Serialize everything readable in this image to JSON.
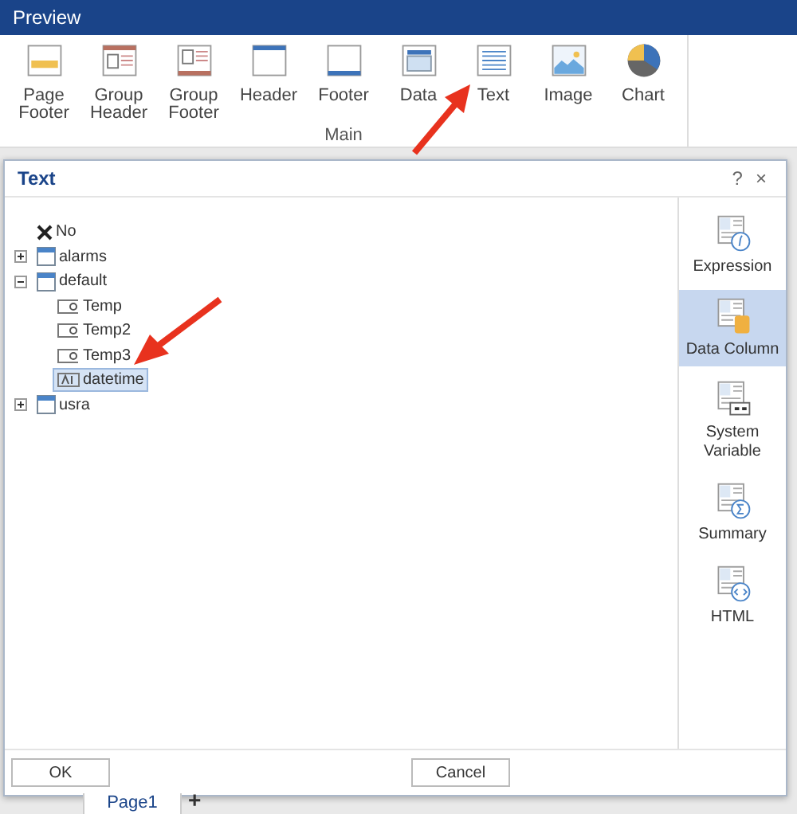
{
  "window": {
    "title": "Preview"
  },
  "ribbon": {
    "group_label": "Main",
    "items": [
      {
        "label": "Page Footer",
        "kind": "page-footer"
      },
      {
        "label": "Group Header",
        "kind": "group-header"
      },
      {
        "label": "Group Footer",
        "kind": "group-footer"
      },
      {
        "label": "Header",
        "kind": "header"
      },
      {
        "label": "Footer",
        "kind": "footer"
      },
      {
        "label": "Data",
        "kind": "data"
      },
      {
        "label": "Text",
        "kind": "text"
      },
      {
        "label": "Image",
        "kind": "image"
      },
      {
        "label": "Chart",
        "kind": "chart"
      }
    ]
  },
  "dialog": {
    "title": "Text",
    "help": "?",
    "close": "×",
    "tree": [
      {
        "label": "No",
        "kind": "none",
        "selected": false
      },
      {
        "label": "alarms",
        "kind": "table",
        "expanded": false,
        "selected": false
      },
      {
        "label": "default",
        "kind": "table",
        "expanded": true,
        "selected": false,
        "children": [
          {
            "label": "Temp",
            "kind": "number",
            "selected": false
          },
          {
            "label": "Temp2",
            "kind": "number",
            "selected": false
          },
          {
            "label": "Temp3",
            "kind": "number",
            "selected": false
          },
          {
            "label": "datetime",
            "kind": "text",
            "selected": true
          }
        ]
      },
      {
        "label": "usra",
        "kind": "table",
        "expanded": false,
        "selected": false
      }
    ],
    "sources": [
      {
        "label": "Expression",
        "kind": "expression",
        "selected": false
      },
      {
        "label": "Data Column",
        "kind": "column",
        "selected": true
      },
      {
        "label": "System Variable",
        "kind": "system",
        "selected": false
      },
      {
        "label": "Summary",
        "kind": "summary",
        "selected": false
      },
      {
        "label": "HTML",
        "kind": "html",
        "selected": false
      }
    ],
    "buttons": [
      "OK",
      "Cancel"
    ]
  },
  "page_tabs": [
    {
      "label": "Page1"
    }
  ],
  "add_tab": "+"
}
